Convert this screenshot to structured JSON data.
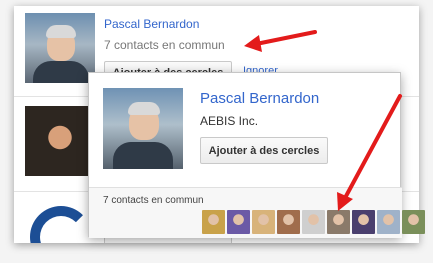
{
  "rows": [
    {
      "name": "Pascal Bernardon",
      "common": "7 contacts en commun",
      "add_button": "Ajouter à des cercles",
      "ignore": "Ignorer"
    }
  ],
  "hovercard": {
    "name": "Pascal Bernardon",
    "company": "AEBIS Inc.",
    "add_button": "Ajouter à des cercles",
    "common": "7 contacts en commun",
    "thumb_colors": [
      "#c9a24a",
      "#6b5aa6",
      "#d8b37a",
      "#a06d4c",
      "#cfcfcf",
      "#8a7a6a",
      "#4a3f6e",
      "#9fb2c9",
      "#7a8f5a"
    ]
  },
  "colors": {
    "link": "#3366cc",
    "arrow": "#e31b1b"
  }
}
